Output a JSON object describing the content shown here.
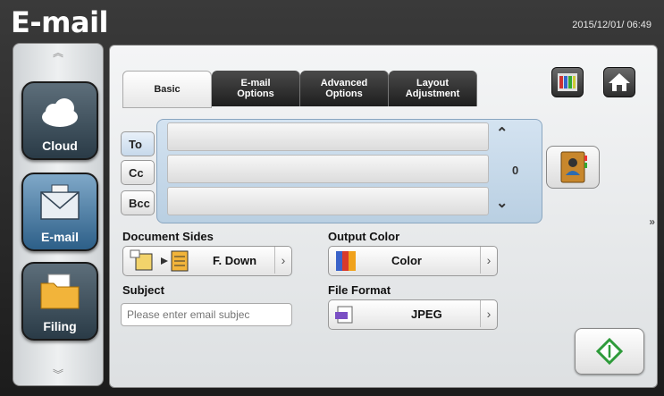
{
  "app": {
    "title": "E-mail",
    "datetime": "2015/12/01/ 06:49"
  },
  "sidebar": {
    "items": [
      {
        "label": "Cloud",
        "icon": "cloud-icon"
      },
      {
        "label": "E-mail",
        "icon": "envelope-icon",
        "active": true
      },
      {
        "label": "Filing",
        "icon": "folder-icon"
      }
    ]
  },
  "tabs": [
    {
      "label": "Basic",
      "active": true
    },
    {
      "label": "E-mail\nOptions"
    },
    {
      "label": "Advanced\nOptions"
    },
    {
      "label": "Layout\nAdjustment"
    }
  ],
  "recipients": {
    "to_label": "To",
    "cc_label": "Cc",
    "bcc_label": "Bcc",
    "count": "0",
    "more": "»"
  },
  "document_sides": {
    "label": "Document Sides",
    "value": "F. Down"
  },
  "output_color": {
    "label": "Output Color",
    "value": "Color"
  },
  "subject": {
    "label": "Subject",
    "placeholder": "Please enter email subjec"
  },
  "file_format": {
    "label": "File Format",
    "value": "JPEG"
  },
  "colors": {
    "accent": "#2d5f88",
    "start_green": "#2e9b3a"
  }
}
